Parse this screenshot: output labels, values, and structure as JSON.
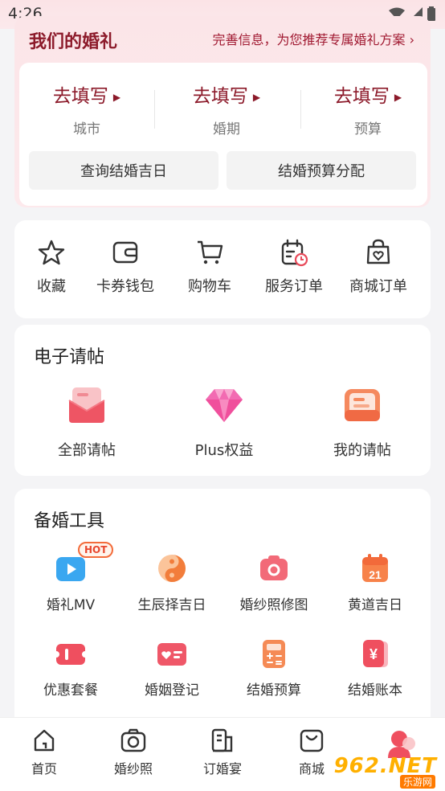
{
  "status_bar": {
    "time": "4:26"
  },
  "wedding": {
    "title": "我们的婚礼",
    "hint": "完善信息，为您推荐专属婚礼方案 ›",
    "fields": [
      {
        "action": "去填写",
        "label": "城市"
      },
      {
        "action": "去填写",
        "label": "婚期"
      },
      {
        "action": "去填写",
        "label": "预算"
      }
    ],
    "buttons": {
      "query_date": "查询结婚吉日",
      "budget": "结婚预算分配"
    }
  },
  "quick_actions": [
    {
      "label": "收藏",
      "icon": "star-icon"
    },
    {
      "label": "卡券钱包",
      "icon": "wallet-icon"
    },
    {
      "label": "购物车",
      "icon": "cart-icon"
    },
    {
      "label": "服务订单",
      "icon": "service-order-icon"
    },
    {
      "label": "商城订单",
      "icon": "mall-order-icon"
    }
  ],
  "invitations": {
    "title": "电子请帖",
    "items": [
      {
        "label": "全部请帖",
        "icon": "envelope-icon"
      },
      {
        "label": "Plus权益",
        "icon": "diamond-icon"
      },
      {
        "label": "我的请帖",
        "icon": "my-invitation-icon"
      }
    ]
  },
  "tools": {
    "title": "备婚工具",
    "hot_badge": "HOT",
    "items": [
      {
        "label": "婚礼MV",
        "icon": "video-icon"
      },
      {
        "label": "生辰择吉日",
        "icon": "yin-yang-icon"
      },
      {
        "label": "婚纱照修图",
        "icon": "camera-icon"
      },
      {
        "label": "黄道吉日",
        "icon": "calendar-icon",
        "day": "21"
      },
      {
        "label": "优惠套餐",
        "icon": "coupon-icon"
      },
      {
        "label": "婚姻登记",
        "icon": "certificate-icon"
      },
      {
        "label": "结婚预算",
        "icon": "calculator-icon"
      },
      {
        "label": "结婚账本",
        "icon": "ledger-icon",
        "symbol": "¥"
      }
    ]
  },
  "bottom_nav": [
    {
      "label": "首页",
      "icon": "home-icon"
    },
    {
      "label": "婚纱照",
      "icon": "camera-icon"
    },
    {
      "label": "订婚宴",
      "icon": "banquet-icon"
    },
    {
      "label": "商城",
      "icon": "shop-bag-icon"
    },
    {
      "label": "",
      "icon": "profile-icon"
    }
  ],
  "watermark": {
    "text": "962.NET",
    "sub": "乐游网"
  },
  "colors": {
    "accent": "#8c1a2a",
    "pink_bg": "#fbe5e8",
    "icon_red": "#ef4f5f"
  }
}
